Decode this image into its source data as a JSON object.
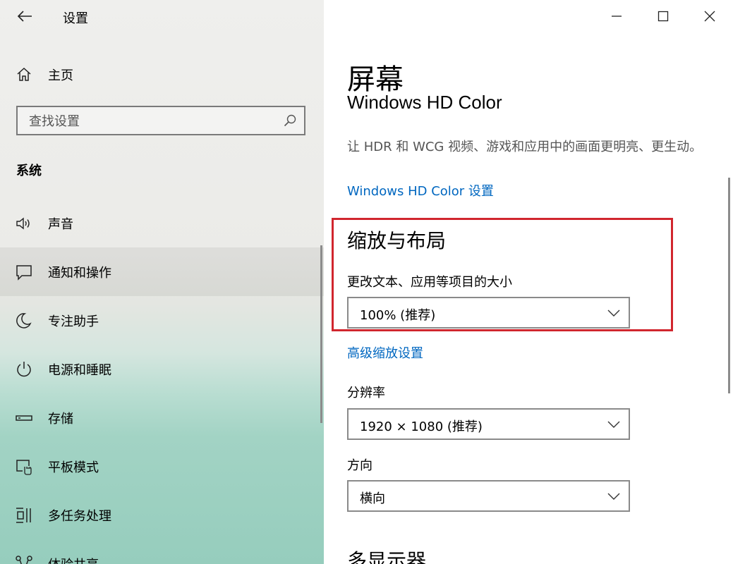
{
  "window": {
    "title": "设置"
  },
  "sidebar": {
    "home_label": "主页",
    "search_placeholder": "查找设置",
    "section_label": "系统",
    "items": [
      {
        "label": "声音",
        "icon": "speaker-icon"
      },
      {
        "label": "通知和操作",
        "icon": "notification-icon",
        "active": true
      },
      {
        "label": "专注助手",
        "icon": "moon-icon"
      },
      {
        "label": "电源和睡眠",
        "icon": "power-icon"
      },
      {
        "label": "存储",
        "icon": "storage-icon"
      },
      {
        "label": "平板模式",
        "icon": "tablet-mode-icon"
      },
      {
        "label": "多任务处理",
        "icon": "multitasking-icon"
      },
      {
        "label": "体验共享",
        "icon": "share-icon"
      }
    ]
  },
  "main": {
    "page_title": "屏幕",
    "hd_heading": "Windows HD Color",
    "hd_description": "让 HDR 和 WCG 视频、游戏和应用中的画面更明亮、更生动。",
    "hd_link": "Windows HD Color 设置",
    "scale_heading": "缩放与布局",
    "scale_label": "更改文本、应用等项目的大小",
    "scale_value": "100% (推荐)",
    "advanced_scale_link": "高级缩放设置",
    "resolution_label": "分辨率",
    "resolution_value": "1920 × 1080 (推荐)",
    "orientation_label": "方向",
    "orientation_value": "横向",
    "multi_display_heading": "多显示器"
  },
  "colors": {
    "accent": "#0067c0",
    "highlight": "#d1262e"
  }
}
